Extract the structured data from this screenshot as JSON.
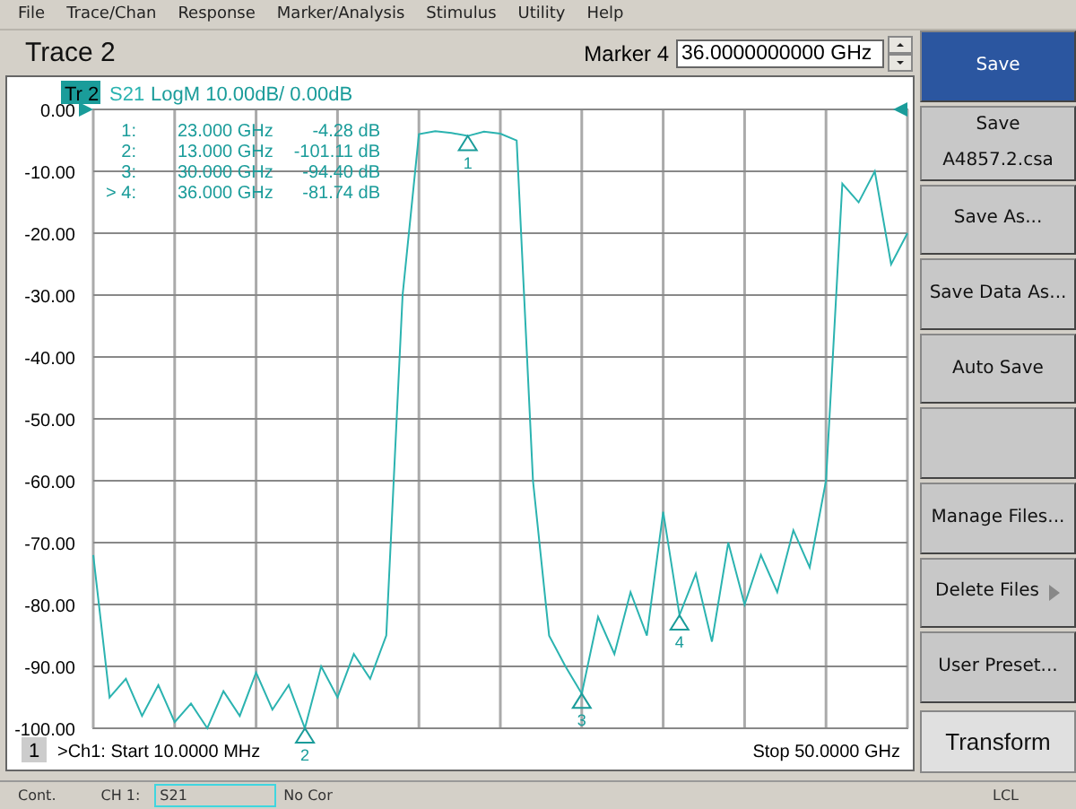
{
  "menu": [
    "File",
    "Trace/Chan",
    "Response",
    "Marker/Analysis",
    "Stimulus",
    "Utility",
    "Help"
  ],
  "toolbar": {
    "title": "Trace 2",
    "marker_label": "Marker 4",
    "marker_value": "36.0000000000 GHz"
  },
  "chart": {
    "trace_tag": "Tr 2",
    "trace_format": "LogM 10.00dB/  0.00dB",
    "channel_number": "1",
    "start": ">Ch1: Start  10.0000 MHz",
    "stop": "Stop  50.0000 GHz",
    "markers": [
      {
        "label": "1:",
        "number": "1",
        "frequency": "23.000 GHz",
        "value": "-4.28 dB"
      },
      {
        "label": "2:",
        "number": "2",
        "frequency": "13.000 GHz",
        "value": "-101.11 dB"
      },
      {
        "label": "3:",
        "number": "3",
        "frequency": "30.000 GHz",
        "value": "-94.40 dB"
      },
      {
        "label": "> 4:",
        "number": "4",
        "frequency": "36.000 GHz",
        "value": "-81.74 dB"
      }
    ],
    "chart_data": {
      "type": "line",
      "categories": [
        null,
        null,
        null,
        null,
        null,
        null,
        null,
        null,
        null,
        null,
        null,
        null,
        null,
        null,
        null,
        null,
        null,
        null,
        null,
        null,
        null,
        null,
        null,
        null,
        null,
        null,
        null,
        null,
        null,
        null,
        null,
        null,
        null,
        null,
        null,
        null,
        null,
        null,
        null,
        null,
        null,
        null,
        null,
        null,
        null,
        null,
        null,
        null,
        null,
        null,
        null
      ],
      "series": [
        {
          "name": "S21",
          "color": "#2bb3b0",
          "values": [
            -72,
            -95,
            -92,
            -98,
            -93,
            -99,
            -96,
            -100,
            -94,
            -98,
            -91,
            -97,
            -93,
            -100,
            -90,
            -95,
            -88,
            -92,
            -85,
            -30,
            -4,
            -3.5,
            -3.8,
            -4.3,
            -3.6,
            -3.9,
            -5,
            -60,
            -85,
            -90,
            -94.4,
            -82,
            -88,
            -78,
            -85,
            -65,
            -81.7,
            -75,
            -86,
            -70,
            -80,
            -72,
            -78,
            -68,
            -74,
            -60,
            -12,
            -15,
            -10,
            -25,
            -20
          ]
        }
      ],
      "ylim": [
        -100,
        0
      ],
      "grid": true,
      "yticks": [
        {
          "value": 0,
          "label": "0.00"
        },
        {
          "value": -10,
          "label": "-10.00"
        },
        {
          "value": -20,
          "label": "-20.00"
        },
        {
          "value": -30,
          "label": "-30.00"
        },
        {
          "value": -40,
          "label": "-40.00"
        },
        {
          "value": -50,
          "label": "-50.00"
        },
        {
          "value": -60,
          "label": "-60.00"
        },
        {
          "value": -70,
          "label": "-70.00"
        },
        {
          "value": -80,
          "label": "-80.00"
        },
        {
          "value": -90,
          "label": "-90.00"
        },
        {
          "value": -100,
          "label": "-100.00"
        }
      ]
    }
  },
  "softkeys": [
    {
      "kind": "key",
      "label": "Save",
      "selected": true
    },
    {
      "kind": "key",
      "label": "Save\nA4857.2.csa",
      "selected": false
    },
    {
      "kind": "key",
      "label": "Save As...",
      "selected": false
    },
    {
      "kind": "key",
      "label": "Save Data As...",
      "selected": false
    },
    {
      "kind": "key",
      "label": "Auto Save",
      "selected": false
    },
    {
      "kind": "blank",
      "selected": false
    },
    {
      "kind": "key",
      "label": "Manage Files...",
      "selected": false
    },
    {
      "kind": "key",
      "label": "Delete Files",
      "submenu": true,
      "selected": false
    },
    {
      "kind": "key",
      "label": "User Preset...",
      "selected": false
    }
  ],
  "transform_button": "Transform",
  "status_bar": {
    "mode": "Cont.",
    "channel": "CH 1:",
    "parameter": "S21",
    "correction": "No Cor",
    "remote": "LCL"
  }
}
